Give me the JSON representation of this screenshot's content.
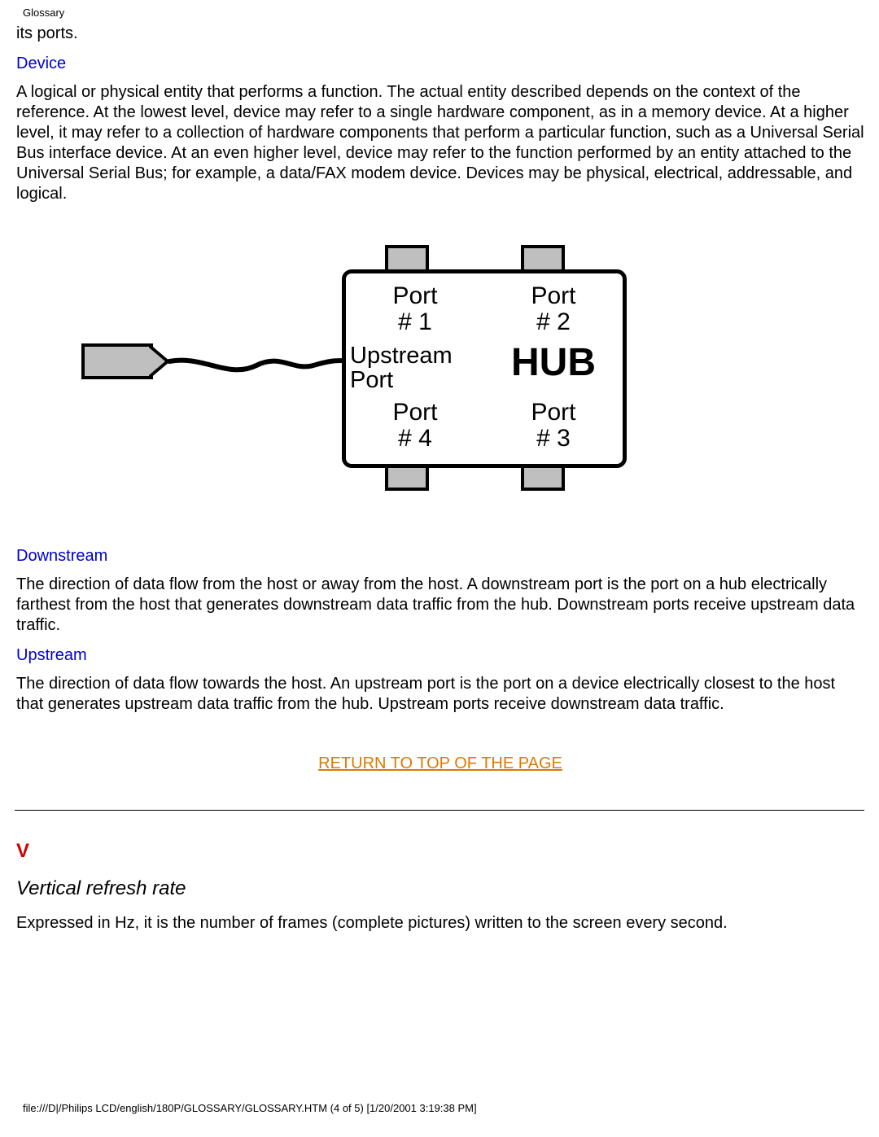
{
  "header": {
    "title": "Glossary"
  },
  "intro_tail": "its ports.",
  "terms": {
    "device": {
      "label": "Device",
      "text": "A logical or physical entity that performs a function. The actual entity described depends on the context of the reference. At the lowest level, device may refer to a single hardware component, as in a memory device. At a higher level, it may refer to a collection of hardware components that perform a particular function, such as a Universal Serial Bus interface device. At an even higher level, device may refer to the function performed by an entity attached to the Universal Serial Bus; for example, a data/FAX modem device. Devices may be physical, electrical, addressable, and logical."
    },
    "downstream": {
      "label": "Downstream",
      "text": "The direction of data flow from the host or away from the host. A downstream port is the port on a hub electrically farthest from the host that generates downstream data traffic from the hub. Downstream ports receive upstream data traffic."
    },
    "upstream": {
      "label": "Upstream",
      "text": "The direction of data flow towards the host. An upstream port is the port on a device electrically closest to the host that generates upstream data traffic from the hub. Upstream ports receive downstream data traffic."
    }
  },
  "diagram": {
    "port1_l1": "Port",
    "port1_l2": "# 1",
    "port2_l1": "Port",
    "port2_l2": "# 2",
    "port3_l1": "Port",
    "port3_l2": "# 3",
    "port4_l1": "Port",
    "port4_l2": "# 4",
    "up_l1": "Upstream",
    "up_l2": "Port",
    "hub": "HUB"
  },
  "return_link": "RETURN TO TOP OF THE PAGE",
  "section_v": {
    "letter": "V",
    "subterm": "Vertical refresh rate",
    "text": "Expressed in Hz, it is the number of frames (complete pictures) written to the screen every second."
  },
  "footer": "file:///D|/Philips LCD/english/180P/GLOSSARY/GLOSSARY.HTM (4 of 5) [1/20/2001 3:19:38 PM]"
}
